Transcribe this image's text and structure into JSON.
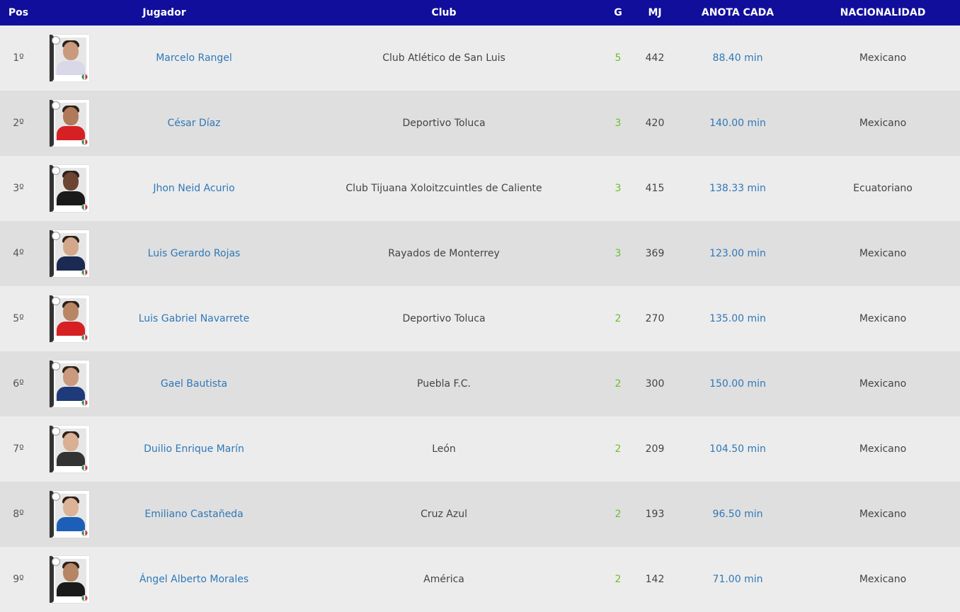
{
  "headers": {
    "pos": "Pos",
    "player": "Jugador",
    "club": "Club",
    "goals": "G",
    "minutes": "MJ",
    "scores_every": "ANOTA CADA",
    "nationality": "NACIONALIDAD"
  },
  "colors": {
    "header_bg": "#100e9b",
    "link": "#2f78b8",
    "goals": "#6cbf2b",
    "row_odd": "#ececec",
    "row_even": "#dfdfdf"
  },
  "rows": [
    {
      "pos": "1º",
      "name": "Marcelo Rangel",
      "club": "Club Atlético de San Luis",
      "goals": "5",
      "mj": "442",
      "anota": "88.40 min",
      "nat": "Mexicano",
      "shirt": "#d8d8e8",
      "skin": "#c99a7e",
      "icon": "player-photo-icon"
    },
    {
      "pos": "2º",
      "name": "César Díaz",
      "club": "Deportivo Toluca",
      "goals": "3",
      "mj": "420",
      "anota": "140.00 min",
      "nat": "Mexicano",
      "shirt": "#d62024",
      "skin": "#b07a5a",
      "icon": "player-photo-icon"
    },
    {
      "pos": "3º",
      "name": "Jhon Neid Acurio",
      "club": "Club Tijuana Xoloitzcuintles de Caliente",
      "goals": "3",
      "mj": "415",
      "anota": "138.33 min",
      "nat": "Ecuatoriano",
      "shirt": "#1a1a1a",
      "skin": "#6b4532",
      "icon": "player-photo-icon"
    },
    {
      "pos": "4º",
      "name": "Luis Gerardo Rojas",
      "club": "Rayados de Monterrey",
      "goals": "3",
      "mj": "369",
      "anota": "123.00 min",
      "nat": "Mexicano",
      "shirt": "#1b2a52",
      "skin": "#d3a88a",
      "icon": "player-photo-icon"
    },
    {
      "pos": "5º",
      "name": "Luis Gabriel Navarrete",
      "club": "Deportivo Toluca",
      "goals": "2",
      "mj": "270",
      "anota": "135.00 min",
      "nat": "Mexicano",
      "shirt": "#d62024",
      "skin": "#b98565",
      "icon": "player-photo-icon"
    },
    {
      "pos": "6º",
      "name": "Gael Bautista",
      "club": "Puebla F.C.",
      "goals": "2",
      "mj": "300",
      "anota": "150.00 min",
      "nat": "Mexicano",
      "shirt": "#1f3a7a",
      "skin": "#c99a7e",
      "icon": "player-photo-icon"
    },
    {
      "pos": "7º",
      "name": "Duilio Enrique Marín",
      "club": "León",
      "goals": "2",
      "mj": "209",
      "anota": "104.50 min",
      "nat": "Mexicano",
      "shirt": "#333333",
      "skin": "#d9b094",
      "icon": "player-photo-icon"
    },
    {
      "pos": "8º",
      "name": "Emiliano Castañeda",
      "club": "Cruz Azul",
      "goals": "2",
      "mj": "193",
      "anota": "96.50 min",
      "nat": "Mexicano",
      "shirt": "#1d5fb8",
      "skin": "#dcb396",
      "icon": "player-photo-icon"
    },
    {
      "pos": "9º",
      "name": "Ángel Alberto Morales",
      "club": "América",
      "goals": "2",
      "mj": "142",
      "anota": "71.00 min",
      "nat": "Mexicano",
      "shirt": "#1a1a1a",
      "skin": "#b58564",
      "icon": "player-photo-icon"
    }
  ]
}
